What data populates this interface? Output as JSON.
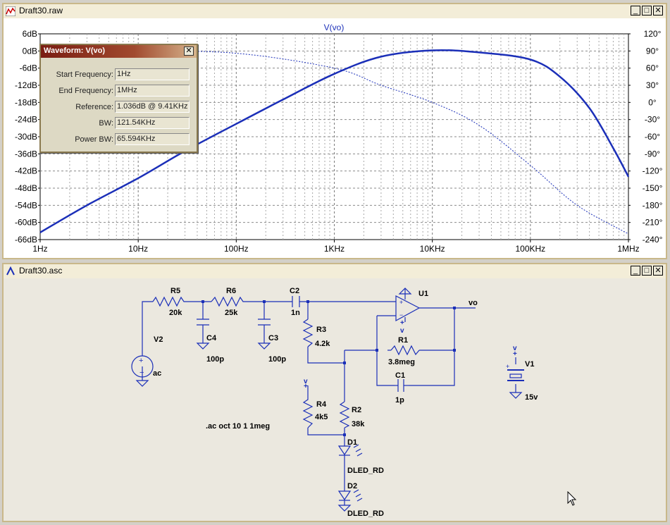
{
  "waveform_window": {
    "title": "Draft30.raw",
    "trace_title": "V(vo)",
    "left_axis_ticks": [
      "6dB",
      "0dB",
      "-6dB",
      "-12dB",
      "-18dB",
      "-24dB",
      "-30dB",
      "-36dB",
      "-42dB",
      "-48dB",
      "-54dB",
      "-60dB",
      "-66dB"
    ],
    "right_axis_ticks": [
      "120°",
      "90°",
      "60°",
      "30°",
      "0°",
      "-30°",
      "-60°",
      "-90°",
      "-120°",
      "-150°",
      "-180°",
      "-210°",
      "-240°"
    ],
    "x_axis_ticks": [
      "1Hz",
      "10Hz",
      "100Hz",
      "1KHz",
      "10KHz",
      "100KHz",
      "1MHz"
    ]
  },
  "chart_data": {
    "type": "line",
    "title": "V(vo)",
    "xscale": "log",
    "xlim": [
      1,
      1000000
    ],
    "ylim_left_db": [
      -66,
      6
    ],
    "ylim_right_deg": [
      -240,
      120
    ],
    "grid": true,
    "series": [
      {
        "style": "solid",
        "axis": "left",
        "unit": "dB",
        "x": [
          1,
          3,
          10,
          30,
          100,
          300,
          1000,
          3000,
          10000,
          30000,
          100000,
          200000,
          400000,
          700000,
          1000000
        ],
        "values": [
          -63.5,
          -54,
          -44.5,
          -35,
          -25.5,
          -17,
          -8,
          -2,
          0.2,
          -0.5,
          -3,
          -9,
          -20,
          -34,
          -44
        ]
      },
      {
        "style": "dashed",
        "axis": "right",
        "unit": "deg",
        "x": [
          1,
          10,
          100,
          1000,
          3000,
          10000,
          30000,
          100000,
          300000,
          1000000
        ],
        "values": [
          90,
          90,
          86,
          60,
          30,
          0,
          -40,
          -110,
          -180,
          -230
        ]
      }
    ]
  },
  "measure_popup": {
    "title": "Waveform: V(vo)",
    "close_glyph": "✕",
    "rows": [
      {
        "label": "Start Frequency:",
        "value": "1Hz"
      },
      {
        "label": "End Frequency:",
        "value": "1MHz"
      },
      {
        "label": "Reference:",
        "value": "1.036dB @ 9.41KHz"
      },
      {
        "label": "BW:",
        "value": "121.54KHz"
      },
      {
        "label": "Power BW:",
        "value": "65.594KHz"
      }
    ]
  },
  "schematic_window": {
    "title": "Draft30.asc",
    "components": {
      "r5": {
        "name": "R5",
        "value": "20k"
      },
      "r6": {
        "name": "R6",
        "value": "25k"
      },
      "c2": {
        "name": "C2",
        "value": "1n"
      },
      "c4": {
        "name": "C4",
        "value": "100p"
      },
      "c3": {
        "name": "C3",
        "value": "100p"
      },
      "r3": {
        "name": "R3",
        "value": "4.2k"
      },
      "u1": {
        "name": "U1"
      },
      "r1": {
        "name": "R1",
        "value": "3.8meg"
      },
      "c1": {
        "name": "C1",
        "value": "1p"
      },
      "v2": {
        "name": "V2",
        "value": "ac"
      },
      "v1": {
        "name": "V1",
        "value": "15v"
      },
      "r4": {
        "name": "R4",
        "value": "4k5"
      },
      "r2": {
        "name": "R2",
        "value": "38k"
      },
      "d1": {
        "name": "D1",
        "value": "DLED_RD"
      },
      "d2": {
        "name": "D2",
        "value": "DLED_RD"
      }
    },
    "net_vo": "vo",
    "plus_v": "+v",
    "directive": ".ac oct 10 1 1meg"
  },
  "window_buttons": {
    "minimize": "_",
    "maximize": "□",
    "close": "✕"
  },
  "colors": {
    "trace": "#1b2fb8",
    "wire": "#1b2fb8",
    "grid": "#808080",
    "schematic_bg": "#ebe8df"
  }
}
